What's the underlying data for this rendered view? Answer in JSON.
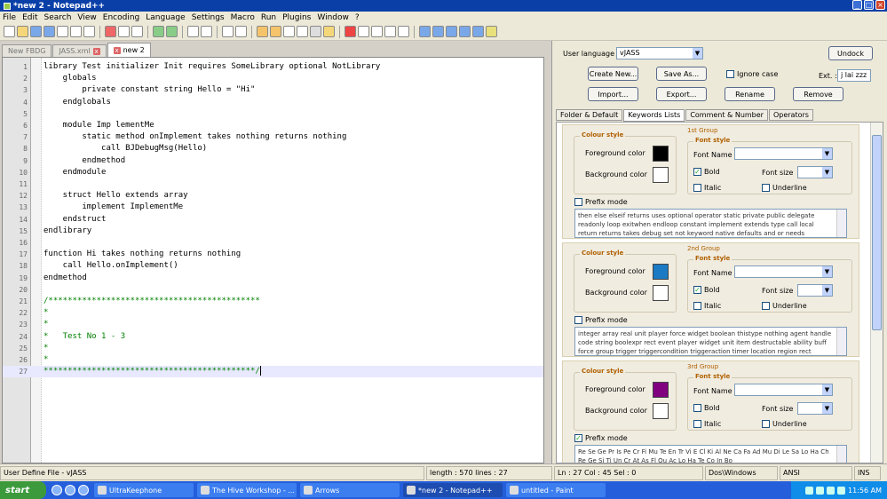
{
  "window": {
    "title": "*new  2 - Notepad++"
  },
  "menu": [
    "File",
    "Edit",
    "Search",
    "View",
    "Encoding",
    "Language",
    "Settings",
    "Macro",
    "Run",
    "Plugins",
    "Window",
    "?"
  ],
  "tabs": [
    {
      "label": "New FBDG",
      "active": false
    },
    {
      "label": "JASS.xml",
      "active": false
    },
    {
      "label": "new  2",
      "active": true
    }
  ],
  "editor": {
    "lines": [
      {
        "n": "1",
        "t": "library Test initializer Init requires SomeLibrary optional NotLibrary"
      },
      {
        "n": "2",
        "t": "    globals"
      },
      {
        "n": "3",
        "t": "        private constant string Hello = \"Hi\""
      },
      {
        "n": "4",
        "t": "    endglobals"
      },
      {
        "n": "5",
        "t": ""
      },
      {
        "n": "6",
        "t": "    module Imp lementMe"
      },
      {
        "n": "7",
        "t": "        static method onImplement takes nothing returns nothing"
      },
      {
        "n": "8",
        "t": "            call BJDebugMsg(Hello)"
      },
      {
        "n": "9",
        "t": "        endmethod"
      },
      {
        "n": "10",
        "t": "    endmodule"
      },
      {
        "n": "11",
        "t": ""
      },
      {
        "n": "12",
        "t": "    struct Hello extends array"
      },
      {
        "n": "13",
        "t": "        implement ImplementMe"
      },
      {
        "n": "14",
        "t": "    endstruct"
      },
      {
        "n": "15",
        "t": "endlibrary"
      },
      {
        "n": "16",
        "t": ""
      },
      {
        "n": "17",
        "t": "function Hi takes nothing returns nothing"
      },
      {
        "n": "18",
        "t": "    call Hello.onImplement()"
      },
      {
        "n": "19",
        "t": "endmethod"
      },
      {
        "n": "20",
        "t": ""
      },
      {
        "n": "21",
        "t": "/********************************************"
      },
      {
        "n": "22",
        "t": "*"
      },
      {
        "n": "23",
        "t": "*"
      },
      {
        "n": "24",
        "t": "*   Test No 1 - 3"
      },
      {
        "n": "25",
        "t": "*"
      },
      {
        "n": "26",
        "t": "*"
      },
      {
        "n": "27",
        "t": "********************************************/"
      }
    ]
  },
  "status": {
    "filetype": "User Define File - vJASS",
    "length": "length : 570   lines : 27",
    "position": "Ln : 27   Col : 45   Sel : 0",
    "eol": "Dos\\Windows",
    "encoding": "ANSI",
    "mode": "INS"
  },
  "udl": {
    "user_language_label": "User language :",
    "user_language_value": "vJASS",
    "undock": "Undock",
    "create_new": "Create New...",
    "save_as": "Save As...",
    "ignore_case": "Ignore case",
    "ext_label": "Ext. :",
    "ext_value": "j lai zzz",
    "import": "Import...",
    "export": "Export...",
    "rename": "Rename",
    "remove": "Remove",
    "tabs": [
      "Folder & Default",
      "Keywords Lists",
      "Comment & Number",
      "Operators"
    ],
    "groups": [
      {
        "title": "1st Group",
        "fg_color": "#000000",
        "bg_color": "#ffffff",
        "bold": true,
        "prefix": false,
        "keywords": "then else elseif returns uses optional operator static private public delegate readonly loop exitwhen endloop constant implement extends type call local return returns takes debug set not keyword native defaults and or needs initializer"
      },
      {
        "title": "2nd Group",
        "fg_color": "#1a7bc4",
        "bg_color": "#ffffff",
        "bold": true,
        "prefix": false,
        "keywords": "integer array real unit player force widget boolean thistype nothing agent handle code string boolexpr rect event player widget unit item destructable ability buff force group trigger triggercondition triggeraction timer location region rect boolexpr key"
      },
      {
        "title": "3rd Group",
        "fg_color": "#800080",
        "bg_color": "#ffffff",
        "bold": false,
        "prefix": true,
        "keywords": "Re Se Ge Pr Is Pe Cr Fi Mu Te En Tr Vi E Cl Ki Al Ne Ca Fa Ad Mu Di Le Sa Lo Ha Ch Re Ge Si Ti Un Cr At As Fl Ou Ac Lo Ha Te Co In Bo"
      }
    ],
    "labels": {
      "colour_style": "Colour style",
      "font_style": "Font style",
      "foreground": "Foreground color",
      "background": "Background color",
      "font_name": "Font Name :",
      "font_size": "Font size",
      "bold": "Bold",
      "italic": "Italic",
      "underline": "Underline",
      "prefix": "Prefix mode"
    }
  },
  "taskbar": {
    "start": "start",
    "tasks": [
      {
        "label": "UltraKeephone",
        "active": false
      },
      {
        "label": "The Hive Workshop - ...",
        "active": false
      },
      {
        "label": "Arrows",
        "active": false
      },
      {
        "label": "*new  2 - Notepad++",
        "active": true
      },
      {
        "label": "untitled - Paint",
        "active": false
      }
    ],
    "clock": "11:56 AM"
  }
}
